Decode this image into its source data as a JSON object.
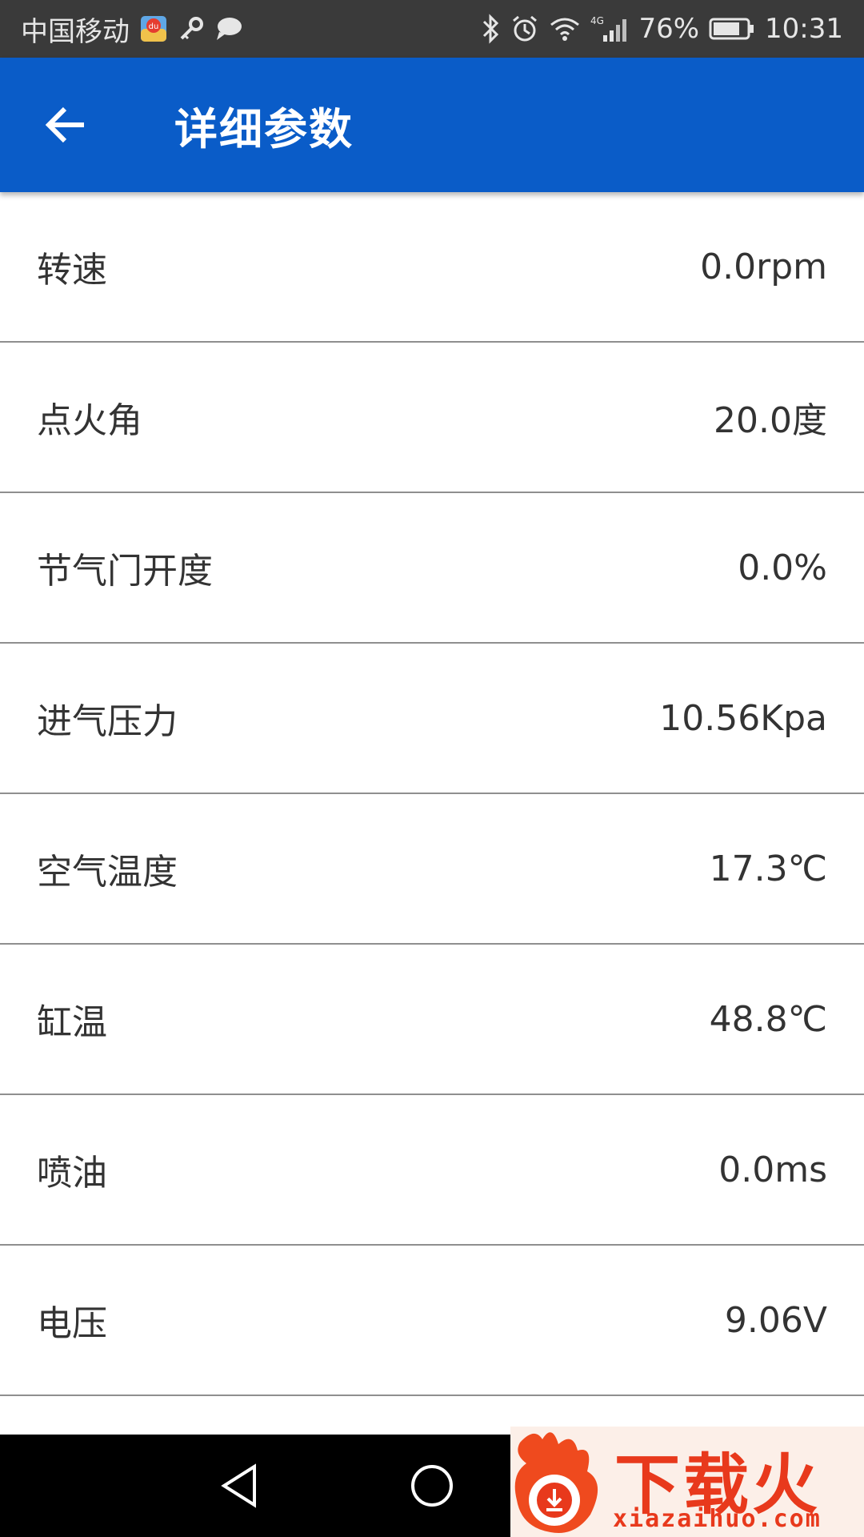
{
  "status_bar": {
    "carrier": "中国移动",
    "network": "4G",
    "battery": "76%",
    "time": "10:31",
    "icons": [
      "baidu-maps-icon",
      "key-icon",
      "chat-bubble-icon",
      "bluetooth-icon",
      "alarm-icon",
      "wifi-icon",
      "signal-icon",
      "battery-icon"
    ]
  },
  "app_bar": {
    "title": "详细参数",
    "back_icon": "arrow-left-icon",
    "color": "#0a5cc8"
  },
  "params": [
    {
      "label": "转速",
      "value": "0.0rpm"
    },
    {
      "label": "点火角",
      "value": "20.0度"
    },
    {
      "label": "节气门开度",
      "value": "0.0%"
    },
    {
      "label": "进气压力",
      "value": "10.56Kpa"
    },
    {
      "label": "空气温度",
      "value": "17.3℃"
    },
    {
      "label": "缸温",
      "value": "48.8℃"
    },
    {
      "label": "喷油",
      "value": "0.0ms"
    },
    {
      "label": "电压",
      "value": "9.06V"
    }
  ],
  "nav_bar": {
    "icons": [
      "back-triangle-icon",
      "home-circle-icon"
    ]
  },
  "watermark": {
    "text_cn": "下载火",
    "text_en": "xiazaihuo.com",
    "color": "#e8391c"
  }
}
